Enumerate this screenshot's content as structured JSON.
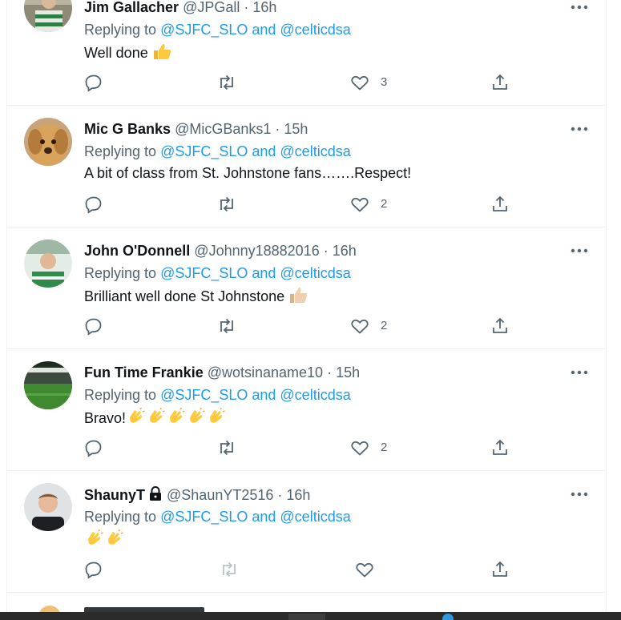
{
  "tweets": [
    {
      "name": "Jim Gallacher",
      "handle": "@JPGall",
      "time": "16h",
      "replying_prefix": "Replying to",
      "replying_to": "@SJFC_SLO and @celticdsa",
      "text": "Well done",
      "emojis": [
        "thumbs-up"
      ],
      "likes": "3"
    },
    {
      "name": "Mic G Banks",
      "handle": "@MicGBanks1",
      "time": "15h",
      "replying_prefix": "Replying to",
      "replying_to": "@SJFC_SLO and @celticdsa",
      "text": "A bit of class from St. Johnstone fans…….Respect!",
      "emojis": [],
      "likes": "2"
    },
    {
      "name": "John O'Donnell",
      "handle": "@Johnny18882016",
      "time": "16h",
      "replying_prefix": "Replying to",
      "replying_to": "@SJFC_SLO and @celticdsa",
      "text": "Brilliant well done St Johnstone",
      "emojis": [
        "thumbs-up-light"
      ],
      "likes": "2"
    },
    {
      "name": "Fun Time Frankie",
      "handle": "@wotsinaname10",
      "time": "15h",
      "replying_prefix": "Replying to",
      "replying_to": "@SJFC_SLO and @celticdsa",
      "text": "Bravo!",
      "emojis": [
        "clap",
        "clap",
        "clap",
        "clap",
        "clap"
      ],
      "likes": "2"
    },
    {
      "name": "ShaunyT",
      "handle": "@ShaunYT2516",
      "time": "16h",
      "replying_prefix": "Replying to",
      "replying_to": "@SJFC_SLO and @celticdsa",
      "text": "",
      "emojis": [
        "clap",
        "clap"
      ],
      "likes": ""
    }
  ],
  "separator": " · ",
  "icons": {
    "more": "more-horizontal-icon",
    "reply": "reply-icon",
    "retweet": "retweet-icon",
    "like": "heart-icon",
    "share": "share-icon",
    "lock": "lock-icon"
  },
  "colors": {
    "link": "#1d9bf0",
    "secondary": "#536471",
    "text": "#0f1419",
    "border": "#eff3f4"
  }
}
